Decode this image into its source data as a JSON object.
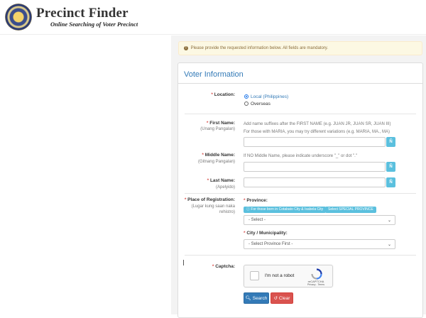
{
  "header": {
    "title": "Precinct Finder",
    "subtitle": "Online Searching of Voter Precinct"
  },
  "alert": {
    "text": "Please provide the requested information below. All fields are mandatory."
  },
  "panel": {
    "title": "Voter Information"
  },
  "location": {
    "label": "Location:",
    "options": [
      "Local (Philippines)",
      "Overseas"
    ],
    "selected": "Local (Philippines)"
  },
  "first_name": {
    "label": "First Name:",
    "sublabel": "(Unang Pangalan)",
    "hint1": "Add name suffixes after the FIRST NAME (e.g. JUAN JR, JUAN SR, JUAN III)",
    "hint2": "For those with MARIA, you may try different variations (e.g. MARIA, MA., MA)",
    "value": "",
    "kb_label": "Ñ"
  },
  "middle_name": {
    "label": "Middle Name:",
    "sublabel": "(Gitnang Pangalan)",
    "hint": "If NO Middle Name, please indicate underscore \"_\" or dot \".\"",
    "value": "",
    "kb_label": "Ñ"
  },
  "last_name": {
    "label": "Last Name:",
    "sublabel": "(Apelyido)",
    "value": "",
    "kb_label": "Ñ"
  },
  "registration": {
    "label": "Place of Registration:",
    "sublabel": "(Lugar kung saan naka rehistro)",
    "province_label": "Province:",
    "btn_cotabato": "For those born in Cotabato City & Isabela City",
    "btn_special": "Select SPECIAL PROVINCE",
    "province_value": "- Select -",
    "city_label": "City / Municipality:",
    "city_value": "- Select Province First -"
  },
  "captcha": {
    "label": "Captcha:",
    "text": "I'm not a robot",
    "brand": "reCAPTCHA",
    "terms": "Privacy - Terms"
  },
  "buttons": {
    "search": "Search",
    "clear": "Clear"
  },
  "colors": {
    "accent": "#337ab7",
    "info": "#5bc0de",
    "danger": "#d9534f",
    "warning_bg": "#fcf8e3"
  }
}
